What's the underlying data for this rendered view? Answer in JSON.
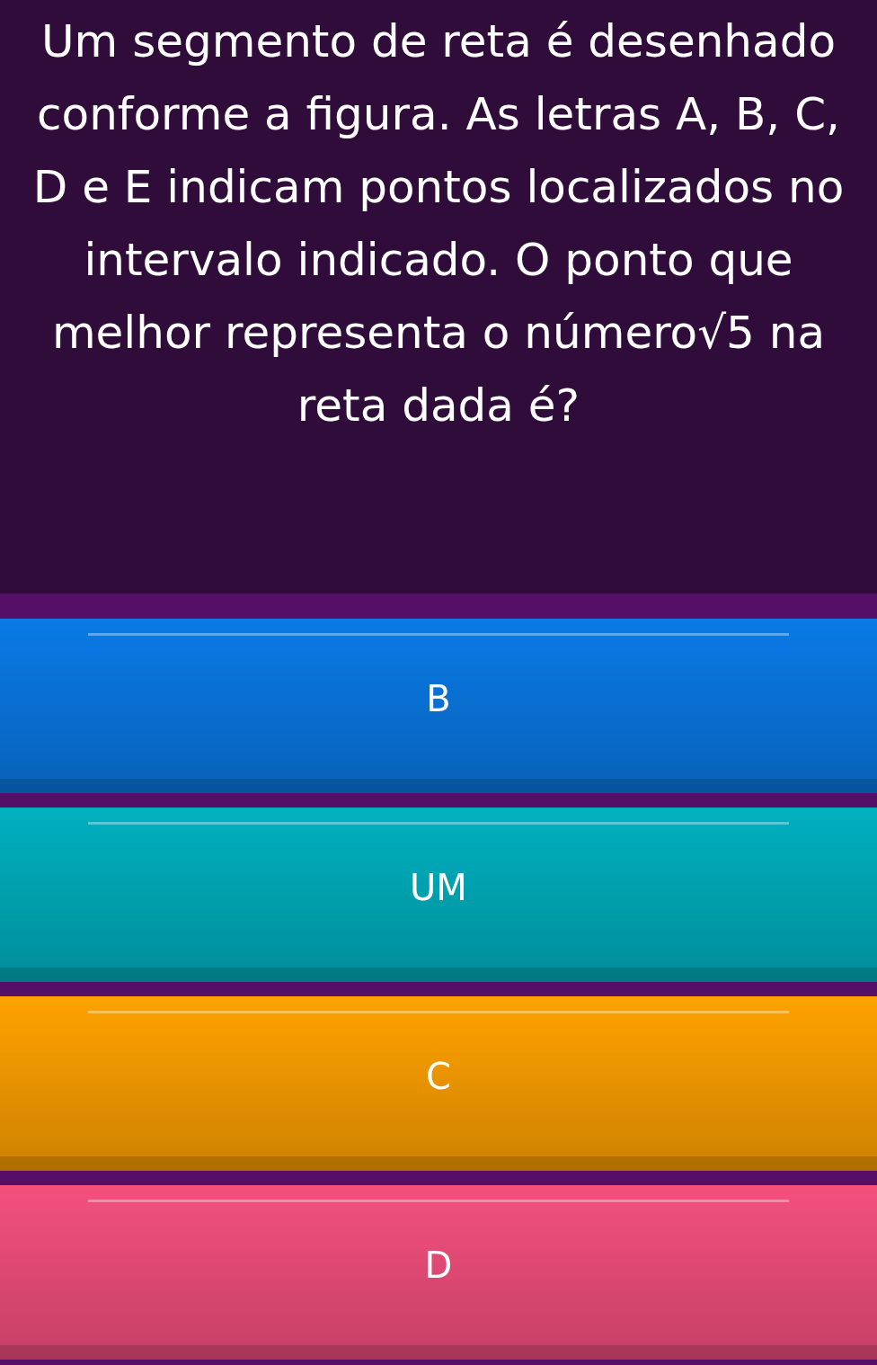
{
  "question": {
    "text": "Um segmento de reta é desenhado conforme a figura. As letras A, B, C, D e E indicam pontos localizados no intervalo indicado. O ponto que melhor representa o número√5 na reta dada é?"
  },
  "options": [
    {
      "label": "B",
      "color": "#0a7ae6"
    },
    {
      "label": "UM",
      "color": "#00b0bf"
    },
    {
      "label": "C",
      "color": "#ffa200"
    },
    {
      "label": "D",
      "color": "#f4507e"
    }
  ]
}
